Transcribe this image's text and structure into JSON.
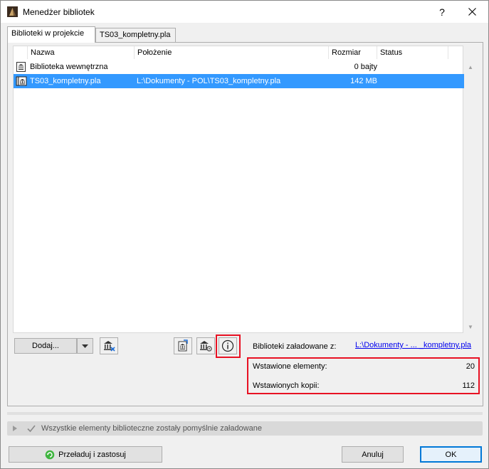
{
  "window": {
    "title": "Menedżer bibliotek",
    "help_label": "?",
    "close_icon": "close-icon"
  },
  "tabs": [
    {
      "label": "Biblioteki w projekcie",
      "active": true
    },
    {
      "label": "TS03_kompletny.pla",
      "active": false
    }
  ],
  "table": {
    "columns": [
      "Nazwa",
      "Położenie",
      "Rozmiar",
      "Status"
    ],
    "rows": [
      {
        "name": "Biblioteka wewnętrzna",
        "location": "",
        "size": "0 bajty",
        "status": "",
        "icon": "embedded-library-icon",
        "selected": false
      },
      {
        "name": "TS03_kompletny.pla",
        "location": "L:\\Dokumenty - POL\\TS03_kompletny.pla",
        "size": "142 MB",
        "status": "",
        "icon": "container-library-icon",
        "selected": true
      }
    ]
  },
  "toolbar": {
    "add_label": "Dodaj...",
    "add_dropdown_icon": "chevron-down-icon",
    "remove_icon": "library-remove-icon",
    "extract_icon": "library-extract-icon",
    "settings_icon": "library-settings-icon",
    "info_icon": "info-icon"
  },
  "details": {
    "loaded_from_label": "Biblioteki załadowane z:",
    "loaded_from_link": "L:\\Dokumenty - ... _kompletny.pla",
    "placed_elements_label": "Wstawione elementy:",
    "placed_elements_value": "20",
    "placed_instances_label": "Wstawionych kopii:",
    "placed_instances_value": "112"
  },
  "status": {
    "message": "Wszystkie elementy biblioteczne zostały pomyślnie załadowane"
  },
  "footer": {
    "reload_label": "Przeładuj i zastosuj",
    "cancel_label": "Anuluj",
    "ok_label": "OK"
  },
  "colors": {
    "selection": "#3399ff",
    "highlight_red": "#e81123",
    "link": "#0000ee"
  }
}
